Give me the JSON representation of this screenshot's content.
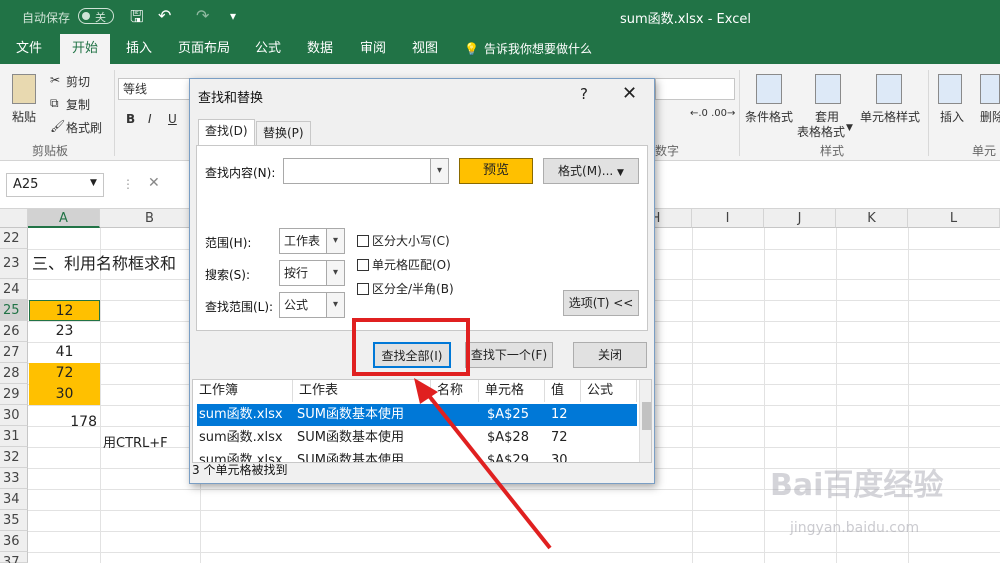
{
  "app": {
    "autosave_label": "自动保存",
    "autosave_state": "关",
    "title": "sum函数.xlsx - Excel"
  },
  "ribbon_tabs": [
    "文件",
    "开始",
    "插入",
    "页面布局",
    "公式",
    "数据",
    "审阅",
    "视图",
    "告诉我你想要做什么"
  ],
  "ribbon": {
    "paste": "粘贴",
    "cut": "剪切",
    "copy": "复制",
    "format_painter": "格式刷",
    "clipboard_group": "剪贴板",
    "font_name": "等线",
    "bold": "B",
    "italic": "I",
    "underline": "U",
    "number_group": "数字",
    "conditional_format": "条件格式",
    "table_format_1": "套用",
    "table_format_2": "表格格式",
    "cell_styles": "单元格样式",
    "styles_group": "样式",
    "insert": "插入",
    "delete": "删除",
    "cells_group": "单元"
  },
  "formula_bar": {
    "name_box": "A25"
  },
  "grid": {
    "columns": [
      "A",
      "B",
      "C",
      "D",
      "E",
      "F",
      "G",
      "H",
      "I",
      "J",
      "K",
      "L"
    ],
    "rows": [
      "22",
      "23",
      "24",
      "25",
      "26",
      "27",
      "28",
      "29",
      "30",
      "31",
      "32",
      "33",
      "34",
      "35",
      "36",
      "37",
      "38"
    ],
    "heading_text": "三、利用名称框求和",
    "values": [
      "12",
      "23",
      "41",
      "72",
      "30"
    ],
    "sum_value": "178",
    "note": "用CTRL+F",
    "highlight_color": "#ffc000"
  },
  "dialog": {
    "title": "查找和替换",
    "help": "?",
    "close": "✕",
    "tab_find": "查找(D)",
    "tab_replace": "替换(P)",
    "find_what_label": "查找内容(N):",
    "find_what_value": "",
    "preview": "预览",
    "format_button": "格式(M)...",
    "within_label": "范围(H):",
    "within_value": "工作表",
    "search_label": "搜索(S):",
    "search_value": "按行",
    "lookin_label": "查找范围(L):",
    "lookin_value": "公式",
    "match_case": "区分大小写(C)",
    "match_cell": "单元格匹配(O)",
    "match_width": "区分全/半角(B)",
    "options_button": "选项(T) <<",
    "find_all": "查找全部(I)",
    "find_next": "查找下一个(F)",
    "close_button": "关闭",
    "results_headers": [
      "工作簿",
      "工作表",
      "名称",
      "单元格",
      "值",
      "公式"
    ],
    "results": [
      {
        "book": "sum函数.xlsx",
        "sheet": "SUM函数基本使用",
        "cell": "$A$25",
        "value": "12"
      },
      {
        "book": "sum函数.xlsx",
        "sheet": "SUM函数基本使用",
        "cell": "$A$28",
        "value": "72"
      },
      {
        "book": "sum函数.xlsx",
        "sheet": "SUM函数基本使用",
        "cell": "$A$29",
        "value": "30"
      }
    ],
    "status": "3 个单元格被找到"
  },
  "watermark": {
    "brand": "Bai百度经验",
    "url": "jingyan.baidu.com"
  }
}
